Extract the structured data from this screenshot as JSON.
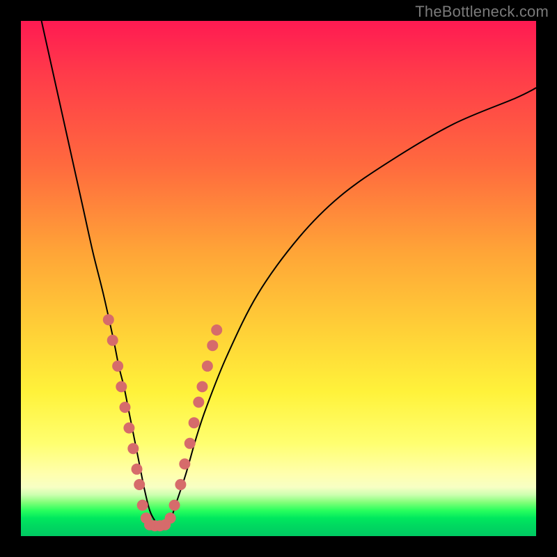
{
  "watermark": "TheBottleneck.com",
  "chart_data": {
    "type": "line",
    "title": "",
    "xlabel": "",
    "ylabel": "",
    "xlim": [
      0,
      100
    ],
    "ylim": [
      0,
      100
    ],
    "grid": false,
    "legend": false,
    "curve": {
      "name": "bottleneck",
      "x": [
        4,
        6,
        8,
        10,
        12,
        14,
        16,
        18,
        19,
        20,
        21,
        22,
        23,
        24,
        25,
        26,
        27,
        28,
        29,
        30,
        32,
        34,
        36,
        40,
        46,
        54,
        62,
        72,
        84,
        96,
        100
      ],
      "y": [
        100,
        91,
        82,
        73,
        64,
        55,
        47,
        38,
        33,
        29,
        24,
        19,
        14,
        9,
        5,
        3,
        2,
        2,
        3,
        6,
        12,
        19,
        25,
        35,
        47,
        58,
        66,
        73,
        80,
        85,
        87
      ],
      "color": "#000000",
      "width": 2
    },
    "dot_series": {
      "name": "sample-points",
      "color": "#d66b6b",
      "radius_px": 8,
      "points": [
        {
          "x": 17.0,
          "y": 42
        },
        {
          "x": 17.8,
          "y": 38
        },
        {
          "x": 18.8,
          "y": 33
        },
        {
          "x": 19.5,
          "y": 29
        },
        {
          "x": 20.2,
          "y": 25
        },
        {
          "x": 21.0,
          "y": 21
        },
        {
          "x": 21.8,
          "y": 17
        },
        {
          "x": 22.5,
          "y": 13
        },
        {
          "x": 23.0,
          "y": 10
        },
        {
          "x": 23.6,
          "y": 6
        },
        {
          "x": 24.3,
          "y": 3.5
        },
        {
          "x": 25.0,
          "y": 2.2
        },
        {
          "x": 26.0,
          "y": 2.0
        },
        {
          "x": 27.0,
          "y": 2.0
        },
        {
          "x": 28.0,
          "y": 2.2
        },
        {
          "x": 29.0,
          "y": 3.5
        },
        {
          "x": 29.8,
          "y": 6
        },
        {
          "x": 31.0,
          "y": 10
        },
        {
          "x": 31.8,
          "y": 14
        },
        {
          "x": 32.8,
          "y": 18
        },
        {
          "x": 33.6,
          "y": 22
        },
        {
          "x": 34.5,
          "y": 26
        },
        {
          "x": 35.2,
          "y": 29
        },
        {
          "x": 36.2,
          "y": 33
        },
        {
          "x": 37.2,
          "y": 37
        },
        {
          "x": 38.0,
          "y": 40
        }
      ]
    }
  }
}
